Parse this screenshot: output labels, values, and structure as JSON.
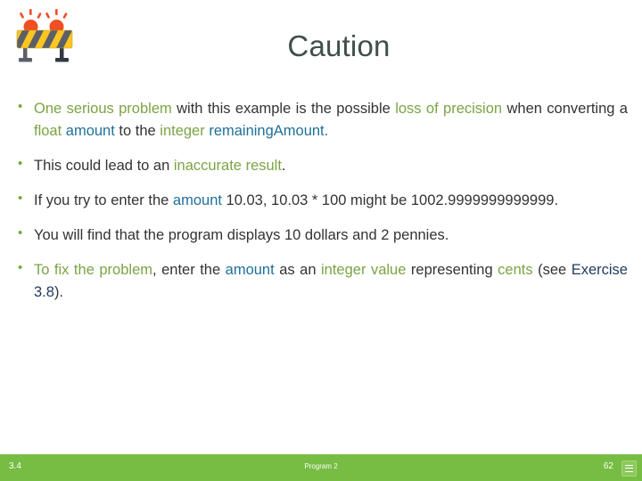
{
  "slide": {
    "title": "Caution",
    "icon_name": "construction-barrier-icon",
    "title_color": "#3f4f49",
    "accent_green": "#7aa444",
    "accent_blue": "#1f7099",
    "footer_bar_color": "#77bc43",
    "bullet_marker_color": "#7aa73c"
  },
  "bullets": [
    {
      "id": "bullet-precision-loss",
      "runs": [
        {
          "text": "One serious problem",
          "color": "green"
        },
        {
          "text": " with this example is the possible ",
          "color": "dark"
        },
        {
          "text": "loss of precision",
          "color": "green"
        },
        {
          "text": " when converting a ",
          "color": "dark"
        },
        {
          "text": "float",
          "color": "green"
        },
        {
          "text": " ",
          "color": "dark"
        },
        {
          "text": "amount",
          "color": "blue"
        },
        {
          "text": " to the ",
          "color": "dark"
        },
        {
          "text": "integer",
          "color": "green"
        },
        {
          "text": " ",
          "color": "dark"
        },
        {
          "text": "remainingAmount",
          "color": "blue"
        },
        {
          "text": ".",
          "color": "dark"
        }
      ]
    },
    {
      "id": "bullet-inaccurate-result",
      "runs": [
        {
          "text": "This could lead to an ",
          "color": "dark"
        },
        {
          "text": "inaccurate result",
          "color": "green"
        },
        {
          "text": ".",
          "color": "dark"
        }
      ]
    },
    {
      "id": "bullet-amount-example",
      "runs": [
        {
          "text": "If you try to enter the ",
          "color": "dark"
        },
        {
          "text": "amount",
          "color": "blue"
        },
        {
          "text": " 10.03, 10.03 * 100 might be 1002.9999999999999.",
          "color": "dark"
        }
      ]
    },
    {
      "id": "bullet-display-result",
      "runs": [
        {
          "text": "You will find that the program displays 10 dollars and 2 pennies.",
          "color": "dark"
        }
      ]
    },
    {
      "id": "bullet-fix-problem",
      "runs": [
        {
          "text": "To fix the problem",
          "color": "green"
        },
        {
          "text": ", enter the ",
          "color": "dark"
        },
        {
          "text": "amount",
          "color": "blue"
        },
        {
          "text": " as an ",
          "color": "dark"
        },
        {
          "text": "integer value",
          "color": "green"
        },
        {
          "text": " representing ",
          "color": "dark"
        },
        {
          "text": "cents",
          "color": "green"
        },
        {
          "text": " (see ",
          "color": "dark"
        },
        {
          "text": "Exercise 3.8",
          "color": "navy"
        },
        {
          "text": ").",
          "color": "dark"
        }
      ]
    }
  ],
  "footer": {
    "left": "3.4",
    "center": "Program 2",
    "right": "62",
    "icon_name": "menu-icon"
  }
}
